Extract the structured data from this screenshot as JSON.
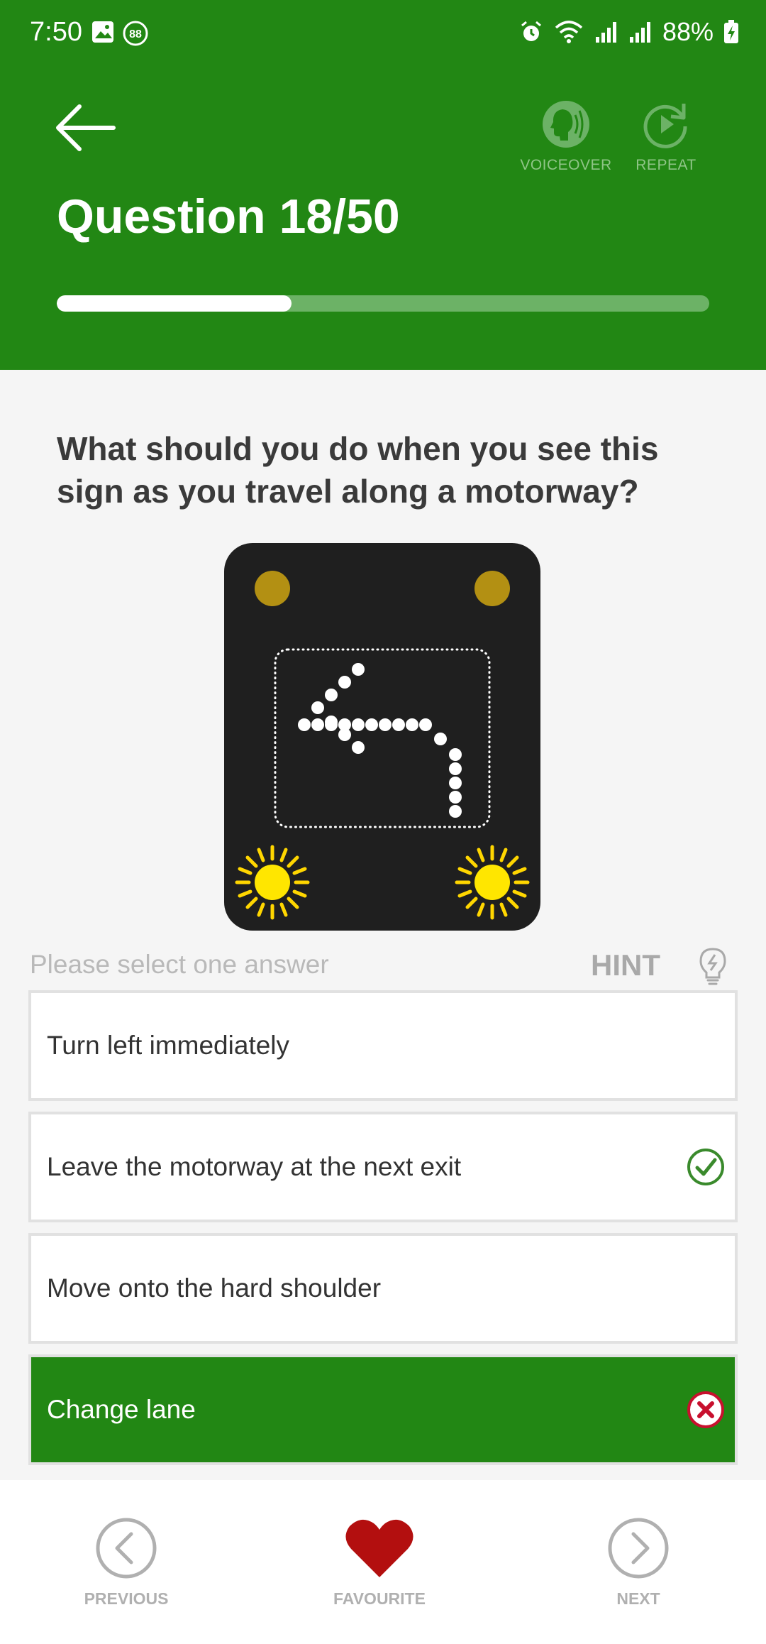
{
  "status": {
    "time": "7:50",
    "battery": "88%",
    "notif_badge": "88"
  },
  "header": {
    "title": "Question 18/50",
    "voiceover_label": "VOICEOVER",
    "repeat_label": "REPEAT",
    "progress_fraction": 0.36
  },
  "question": {
    "text": "What should you do when you see this sign as you travel along a motorway?"
  },
  "prompt": {
    "select_label": "Please select one answer",
    "hint_label": "HINT"
  },
  "answers": [
    {
      "label": "Turn left immediately",
      "state": "none"
    },
    {
      "label": "Leave the motorway at the next exit",
      "state": "correct"
    },
    {
      "label": "Move onto the hard shoulder",
      "state": "none"
    },
    {
      "label": "Change lane",
      "state": "selected-wrong"
    }
  ],
  "nav": {
    "previous_label": "PREVIOUS",
    "favourite_label": "FAVOURITE",
    "next_label": "NEXT"
  },
  "colors": {
    "brand_green": "#228714",
    "favourite_red": "#b30f0f",
    "correct_green": "#3a8a2c",
    "wrong_red": "#c8102e"
  }
}
